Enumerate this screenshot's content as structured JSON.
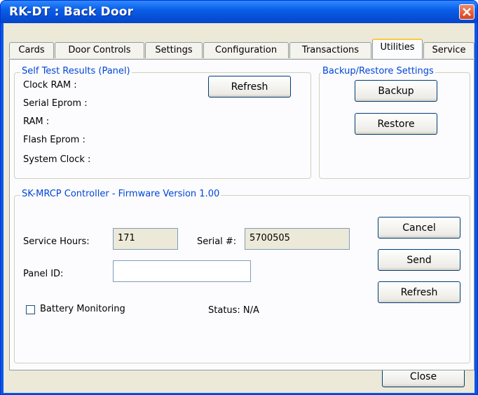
{
  "window": {
    "title": "RK-DT : Back Door"
  },
  "tabs": [
    "Cards",
    "Door Controls",
    "Settings",
    "Configuration",
    "Transactions",
    "Utilities",
    "Service"
  ],
  "self_test": {
    "title": "Self Test Results (Panel)",
    "labels": [
      "Clock RAM :",
      "Serial Eprom :",
      "RAM :",
      "Flash Eprom :",
      "System Clock :"
    ],
    "refresh_label": "Refresh"
  },
  "backup_restore": {
    "title": "Backup/Restore Settings",
    "backup_label": "Backup",
    "restore_label": "Restore"
  },
  "controller": {
    "title": "SK-MRCP Controller - Firmware Version 1.00",
    "service_hours_label": "Service Hours:",
    "service_hours_value": "171",
    "serial_label": "Serial #:",
    "serial_value": "5700505",
    "panel_id_label": "Panel ID:",
    "panel_id_value": "",
    "battery_label": "Battery Monitoring",
    "battery_checked": false,
    "status_label": "Status: N/A",
    "cancel_label": "Cancel",
    "send_label": "Send",
    "refresh_label": "Refresh"
  },
  "footer": {
    "close_label": "Close"
  },
  "colors": {
    "accent": "#0046d5",
    "title_bar": "#0a5ee8",
    "dialog_bg": "#ece9d8"
  }
}
